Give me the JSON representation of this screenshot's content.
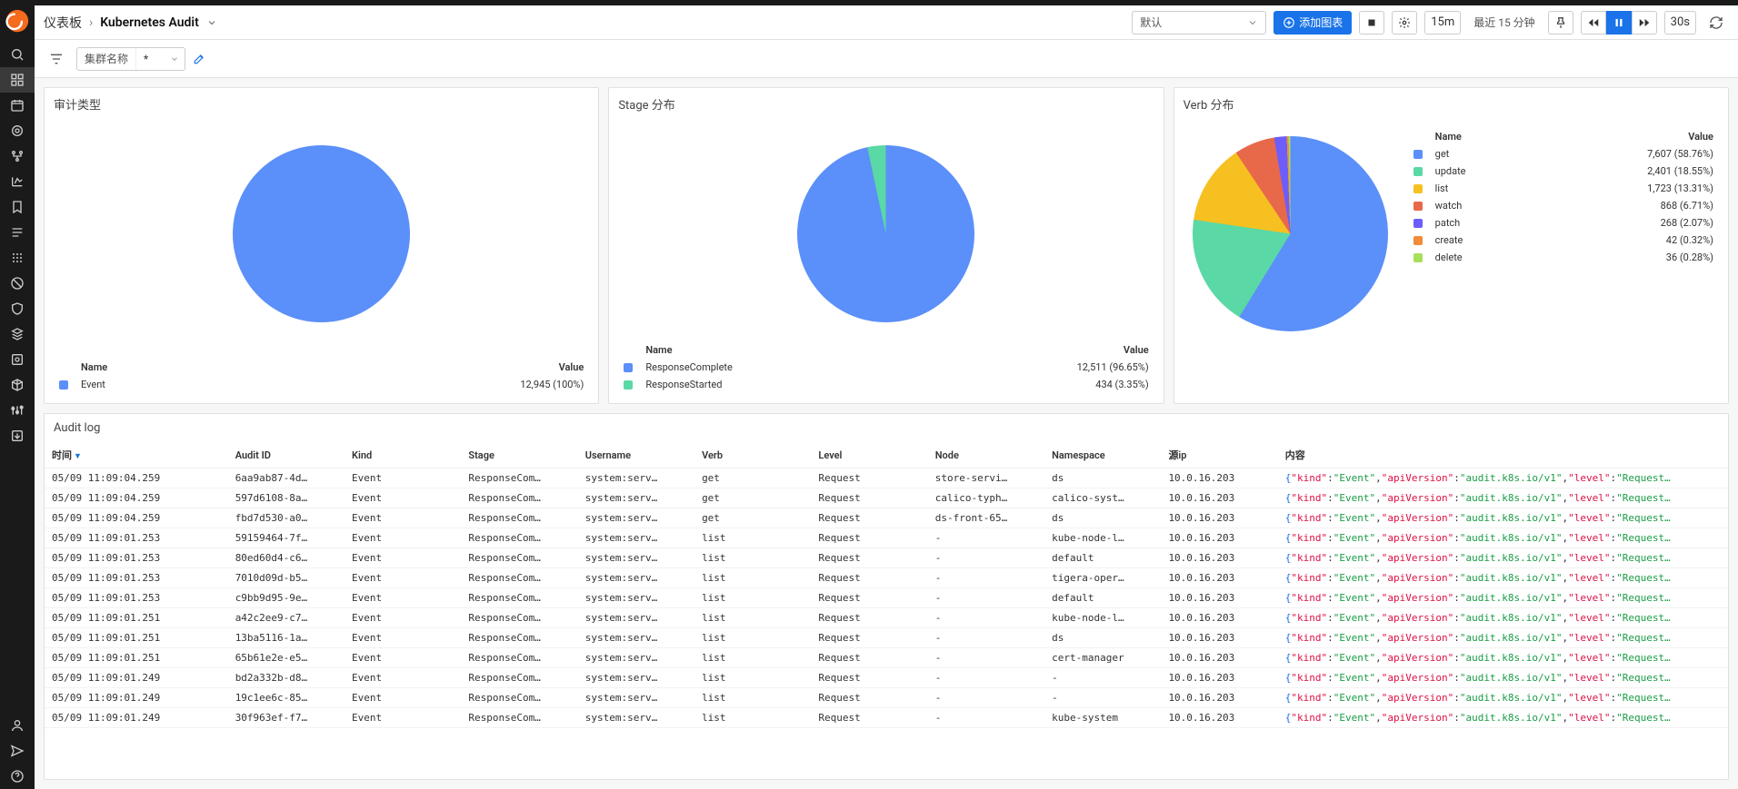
{
  "header": {
    "breadcrumb_root": "仪表板",
    "breadcrumb_current": "Kubernetes Audit",
    "select_default": "默认",
    "add_chart": "添加图表",
    "time_short": "15m",
    "time_label": "最近 15 分钟",
    "refresh_interval": "30s"
  },
  "filters": {
    "cluster_label": "集群名称",
    "cluster_value": "*"
  },
  "panels": {
    "audit_type": {
      "title": "审计类型",
      "legend_head_name": "Name",
      "legend_head_value": "Value"
    },
    "stage": {
      "title": "Stage 分布",
      "legend_head_name": "Name",
      "legend_head_value": "Value"
    },
    "verb": {
      "title": "Verb 分布",
      "legend_head_name": "Name",
      "legend_head_value": "Value"
    },
    "log": {
      "title": "Audit log",
      "cols": {
        "time": "时间",
        "audit_id": "Audit ID",
        "kind": "Kind",
        "stage": "Stage",
        "username": "Username",
        "verb": "Verb",
        "level": "Level",
        "node": "Node",
        "namespace": "Namespace",
        "source_ip": "源ip",
        "content": "内容"
      }
    }
  },
  "chart_data": [
    {
      "id": "audit_type",
      "type": "pie",
      "title": "审计类型",
      "series": [
        {
          "name": "Event",
          "value": 12945,
          "pct": 100.0,
          "display": "12,945 (100%)",
          "color": "#5b8ff9"
        }
      ]
    },
    {
      "id": "stage",
      "type": "pie",
      "title": "Stage 分布",
      "series": [
        {
          "name": "ResponseComplete",
          "value": 12511,
          "pct": 96.65,
          "display": "12,511 (96.65%)",
          "color": "#5b8ff9"
        },
        {
          "name": "ResponseStarted",
          "value": 434,
          "pct": 3.35,
          "display": "434 (3.35%)",
          "color": "#5ad8a6"
        }
      ]
    },
    {
      "id": "verb",
      "type": "pie",
      "title": "Verb 分布",
      "series": [
        {
          "name": "get",
          "value": 7607,
          "pct": 58.76,
          "display": "7,607 (58.76%)",
          "color": "#5b8ff9"
        },
        {
          "name": "update",
          "value": 2401,
          "pct": 18.55,
          "display": "2,401 (18.55%)",
          "color": "#5ad8a6"
        },
        {
          "name": "list",
          "value": 1723,
          "pct": 13.31,
          "display": "1,723 (13.31%)",
          "color": "#f6c021"
        },
        {
          "name": "watch",
          "value": 868,
          "pct": 6.71,
          "display": "868 (6.71%)",
          "color": "#e8684a"
        },
        {
          "name": "patch",
          "value": 268,
          "pct": 2.07,
          "display": "268 (2.07%)",
          "color": "#6d5efb"
        },
        {
          "name": "create",
          "value": 42,
          "pct": 0.32,
          "display": "42 (0.32%)",
          "color": "#f08c3a"
        },
        {
          "name": "delete",
          "value": 36,
          "pct": 0.28,
          "display": "36 (0.28%)",
          "color": "#a6e05c"
        }
      ]
    }
  ],
  "log_rows": [
    {
      "time": "05/09 11:09:04.259",
      "audit_id": "6aa9ab87-4d…",
      "kind": "Event",
      "stage": "ResponseCom…",
      "username": "system:serv…",
      "verb": "get",
      "level": "Request",
      "node": "store-servi…",
      "namespace": "ds",
      "source_ip": "10.0.16.203"
    },
    {
      "time": "05/09 11:09:04.259",
      "audit_id": "597d6108-8a…",
      "kind": "Event",
      "stage": "ResponseCom…",
      "username": "system:serv…",
      "verb": "get",
      "level": "Request",
      "node": "calico-typh…",
      "namespace": "calico-syst…",
      "source_ip": "10.0.16.203"
    },
    {
      "time": "05/09 11:09:04.259",
      "audit_id": "fbd7d530-a0…",
      "kind": "Event",
      "stage": "ResponseCom…",
      "username": "system:serv…",
      "verb": "get",
      "level": "Request",
      "node": "ds-front-65…",
      "namespace": "ds",
      "source_ip": "10.0.16.203"
    },
    {
      "time": "05/09 11:09:01.253",
      "audit_id": "59159464-7f…",
      "kind": "Event",
      "stage": "ResponseCom…",
      "username": "system:serv…",
      "verb": "list",
      "level": "Request",
      "node": "-",
      "namespace": "kube-node-l…",
      "source_ip": "10.0.16.203"
    },
    {
      "time": "05/09 11:09:01.253",
      "audit_id": "80ed60d4-c6…",
      "kind": "Event",
      "stage": "ResponseCom…",
      "username": "system:serv…",
      "verb": "list",
      "level": "Request",
      "node": "-",
      "namespace": "default",
      "source_ip": "10.0.16.203"
    },
    {
      "time": "05/09 11:09:01.253",
      "audit_id": "7010d09d-b5…",
      "kind": "Event",
      "stage": "ResponseCom…",
      "username": "system:serv…",
      "verb": "list",
      "level": "Request",
      "node": "-",
      "namespace": "tigera-oper…",
      "source_ip": "10.0.16.203"
    },
    {
      "time": "05/09 11:09:01.253",
      "audit_id": "c9bb9d95-9e…",
      "kind": "Event",
      "stage": "ResponseCom…",
      "username": "system:serv…",
      "verb": "list",
      "level": "Request",
      "node": "-",
      "namespace": "default",
      "source_ip": "10.0.16.203"
    },
    {
      "time": "05/09 11:09:01.251",
      "audit_id": "a42c2ee9-c7…",
      "kind": "Event",
      "stage": "ResponseCom…",
      "username": "system:serv…",
      "verb": "list",
      "level": "Request",
      "node": "-",
      "namespace": "kube-node-l…",
      "source_ip": "10.0.16.203"
    },
    {
      "time": "05/09 11:09:01.251",
      "audit_id": "13ba5116-1a…",
      "kind": "Event",
      "stage": "ResponseCom…",
      "username": "system:serv…",
      "verb": "list",
      "level": "Request",
      "node": "-",
      "namespace": "ds",
      "source_ip": "10.0.16.203"
    },
    {
      "time": "05/09 11:09:01.251",
      "audit_id": "65b61e2e-e5…",
      "kind": "Event",
      "stage": "ResponseCom…",
      "username": "system:serv…",
      "verb": "list",
      "level": "Request",
      "node": "-",
      "namespace": "cert-manager",
      "source_ip": "10.0.16.203"
    },
    {
      "time": "05/09 11:09:01.249",
      "audit_id": "bd2a332b-d8…",
      "kind": "Event",
      "stage": "ResponseCom…",
      "username": "system:serv…",
      "verb": "list",
      "level": "Request",
      "node": "-",
      "namespace": "-",
      "source_ip": "10.0.16.203"
    },
    {
      "time": "05/09 11:09:01.249",
      "audit_id": "19c1ee6c-85…",
      "kind": "Event",
      "stage": "ResponseCom…",
      "username": "system:serv…",
      "verb": "list",
      "level": "Request",
      "node": "-",
      "namespace": "-",
      "source_ip": "10.0.16.203"
    },
    {
      "time": "05/09 11:09:01.249",
      "audit_id": "30f963ef-f7…",
      "kind": "Event",
      "stage": "ResponseCom…",
      "username": "system:serv…",
      "verb": "list",
      "level": "Request",
      "node": "-",
      "namespace": "kube-system",
      "source_ip": "10.0.16.203"
    }
  ],
  "log_content_template": {
    "open": "{",
    "k_kind": "\"kind\"",
    "v_kind": "\"Event\"",
    "k_api": "\"apiVersion\"",
    "v_api": "\"audit.k8s.io/v1\"",
    "k_level": "\"level\"",
    "v_level": "\"Request…",
    "sep": ":",
    "comma": ","
  },
  "colors": {
    "primary": "#1a73e8"
  }
}
